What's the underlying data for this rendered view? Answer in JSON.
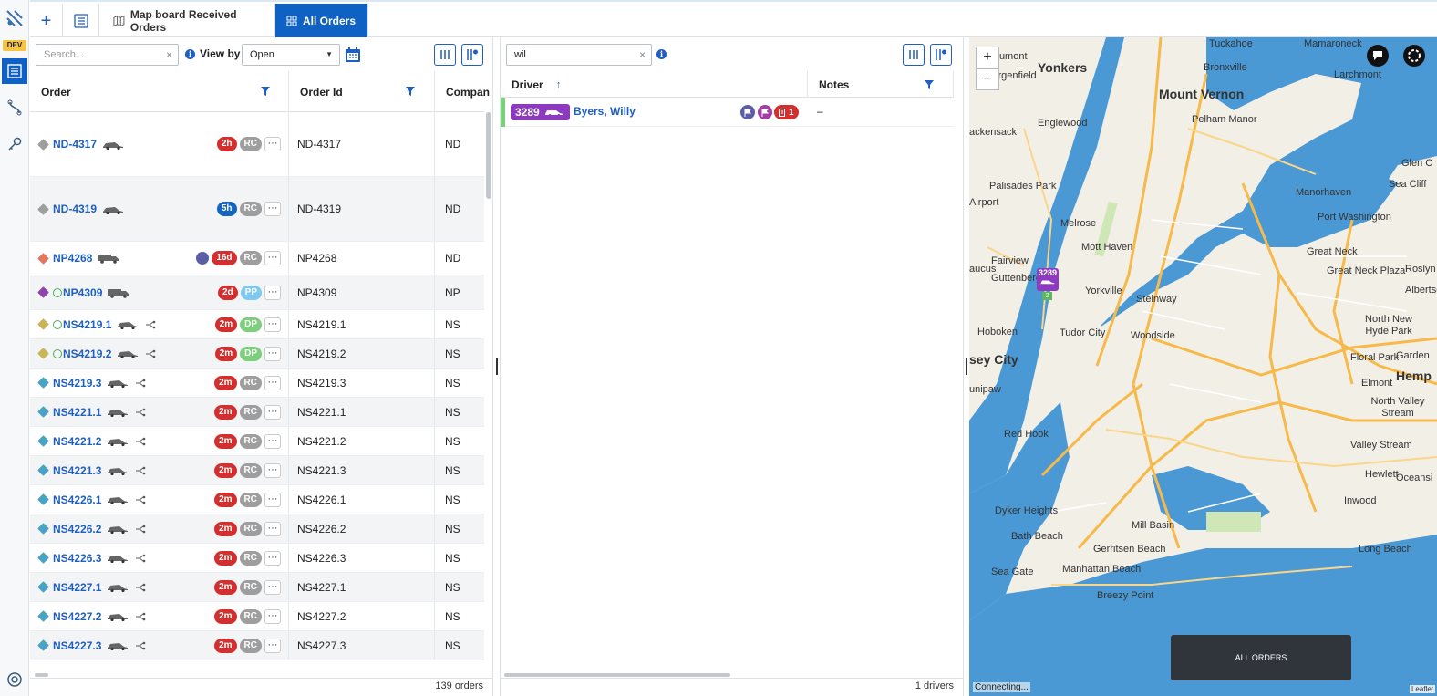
{
  "rail": {
    "dev_badge": "DEV",
    "items": [
      {
        "icon": "app-logo-icon"
      },
      {
        "icon": "orders-list-icon"
      },
      {
        "icon": "route-icon"
      },
      {
        "icon": "key-icon"
      },
      {
        "icon": "help-lifebuoy-icon"
      }
    ]
  },
  "topbar": {
    "add_icon": "plus-icon",
    "list_icon": "list-icon",
    "tabs": [
      {
        "label": "Map board Received Orders",
        "icon": "map-icon",
        "active": false
      },
      {
        "label": "All Orders",
        "icon": "grid-icon",
        "active": true
      }
    ]
  },
  "orders_panel": {
    "search_placeholder": "Search...",
    "view_by_label": "View by",
    "view_by_value": "Open",
    "columns": [
      "Order",
      "Order Id",
      "Compan"
    ],
    "rows": [
      {
        "name": "ND-4317",
        "tag": "#9e9e9e",
        "vehicle": "car",
        "age": "2h",
        "age_color": "red",
        "status": "RC",
        "order_id": "ND-4317",
        "company": "ND",
        "flag": false,
        "app": false,
        "branch": false,
        "tall": true
      },
      {
        "name": "ND-4319",
        "tag": "#9e9e9e",
        "vehicle": "car",
        "age": "5h",
        "age_color": "blue",
        "status": "RC",
        "order_id": "ND-4319",
        "company": "ND",
        "flag": false,
        "app": false,
        "branch": false,
        "tall": true
      },
      {
        "name": "NP4268",
        "tag": "#e07a5f",
        "vehicle": "truck",
        "age": "16d",
        "age_color": "red",
        "status": "RC",
        "order_id": "NP4268",
        "company": "ND",
        "flag": true,
        "app": false,
        "branch": false,
        "tall": false
      },
      {
        "name": "NP4309",
        "tag": "#8e44ad",
        "vehicle": "truck",
        "age": "2d",
        "age_color": "red",
        "status": "PP",
        "order_id": "NP4309",
        "company": "NP",
        "flag": false,
        "app": true,
        "branch": false,
        "tall": false
      },
      {
        "name": "NS4219.1",
        "tag": "#c9b458",
        "vehicle": "car",
        "age": "2m",
        "age_color": "red",
        "status": "DP",
        "order_id": "NS4219.1",
        "company": "NS",
        "flag": false,
        "app": true,
        "branch": true,
        "tall": false
      },
      {
        "name": "NS4219.2",
        "tag": "#c9b458",
        "vehicle": "car",
        "age": "2m",
        "age_color": "red",
        "status": "DP",
        "order_id": "NS4219.2",
        "company": "NS",
        "flag": false,
        "app": true,
        "branch": true,
        "tall": false
      },
      {
        "name": "NS4219.3",
        "tag": "#4aa3c7",
        "vehicle": "car",
        "age": "2m",
        "age_color": "red",
        "status": "RC",
        "order_id": "NS4219.3",
        "company": "NS",
        "flag": false,
        "app": false,
        "branch": true,
        "tall": false
      },
      {
        "name": "NS4221.1",
        "tag": "#4aa3c7",
        "vehicle": "car",
        "age": "2m",
        "age_color": "red",
        "status": "RC",
        "order_id": "NS4221.1",
        "company": "NS",
        "flag": false,
        "app": false,
        "branch": true,
        "tall": false
      },
      {
        "name": "NS4221.2",
        "tag": "#4aa3c7",
        "vehicle": "car",
        "age": "2m",
        "age_color": "red",
        "status": "RC",
        "order_id": "NS4221.2",
        "company": "NS",
        "flag": false,
        "app": false,
        "branch": true,
        "tall": false
      },
      {
        "name": "NS4221.3",
        "tag": "#4aa3c7",
        "vehicle": "car",
        "age": "2m",
        "age_color": "red",
        "status": "RC",
        "order_id": "NS4221.3",
        "company": "NS",
        "flag": false,
        "app": false,
        "branch": true,
        "tall": false
      },
      {
        "name": "NS4226.1",
        "tag": "#4aa3c7",
        "vehicle": "car",
        "age": "2m",
        "age_color": "red",
        "status": "RC",
        "order_id": "NS4226.1",
        "company": "NS",
        "flag": false,
        "app": false,
        "branch": true,
        "tall": false
      },
      {
        "name": "NS4226.2",
        "tag": "#4aa3c7",
        "vehicle": "car",
        "age": "2m",
        "age_color": "red",
        "status": "RC",
        "order_id": "NS4226.2",
        "company": "NS",
        "flag": false,
        "app": false,
        "branch": true,
        "tall": false
      },
      {
        "name": "NS4226.3",
        "tag": "#4aa3c7",
        "vehicle": "car",
        "age": "2m",
        "age_color": "red",
        "status": "RC",
        "order_id": "NS4226.3",
        "company": "NS",
        "flag": false,
        "app": false,
        "branch": true,
        "tall": false
      },
      {
        "name": "NS4227.1",
        "tag": "#4aa3c7",
        "vehicle": "car",
        "age": "2m",
        "age_color": "red",
        "status": "RC",
        "order_id": "NS4227.1",
        "company": "NS",
        "flag": false,
        "app": false,
        "branch": true,
        "tall": false
      },
      {
        "name": "NS4227.2",
        "tag": "#4aa3c7",
        "vehicle": "car",
        "age": "2m",
        "age_color": "red",
        "status": "RC",
        "order_id": "NS4227.2",
        "company": "NS",
        "flag": false,
        "app": false,
        "branch": true,
        "tall": false
      },
      {
        "name": "NS4227.3",
        "tag": "#4aa3c7",
        "vehicle": "car",
        "age": "2m",
        "age_color": "red",
        "status": "RC",
        "order_id": "NS4227.3",
        "company": "NS",
        "flag": false,
        "app": false,
        "branch": true,
        "tall": false
      }
    ],
    "footer": "139 orders"
  },
  "drivers_panel": {
    "search_value": "wil",
    "columns": [
      "Driver",
      "Notes"
    ],
    "rows": [
      {
        "vehicle_id": "3289",
        "name": "Byers, Willy",
        "notes": "–",
        "count": "1"
      }
    ],
    "footer": "1 drivers"
  },
  "map": {
    "zoom_in": "+",
    "zoom_out": "−",
    "marker_id": "3289",
    "marker_sub": "2",
    "places": [
      {
        "t": "Tuckahoe",
        "b": false
      },
      {
        "t": "Mamaroneck",
        "b": false
      },
      {
        "t": "Dumont",
        "b": false
      },
      {
        "t": "Yonkers",
        "b": true
      },
      {
        "t": "Bronxville",
        "b": false
      },
      {
        "t": "Larchmont",
        "b": false
      },
      {
        "t": "Bergenfield",
        "b": false
      },
      {
        "t": "Mount Vernon",
        "b": true
      },
      {
        "t": "Pelham Manor",
        "b": false
      },
      {
        "t": "Englewood",
        "b": false
      },
      {
        "t": "ackensack",
        "b": false
      },
      {
        "t": "Palisades Park",
        "b": false
      },
      {
        "t": "Manorhaven",
        "b": false
      },
      {
        "t": "Port Washington",
        "b": false
      },
      {
        "t": "Fairview",
        "b": false
      },
      {
        "t": "Melrose",
        "b": false
      },
      {
        "t": "Great Neck",
        "b": false
      },
      {
        "t": "Great Neck Plaza",
        "b": false
      },
      {
        "t": "Roslyn Height",
        "b": false
      },
      {
        "t": "Guttenberg",
        "b": false
      },
      {
        "t": "Mott Haven",
        "b": false
      },
      {
        "t": "Yorkville",
        "b": false
      },
      {
        "t": "Steinway",
        "b": false
      },
      {
        "t": "Hoboken",
        "b": false
      },
      {
        "t": "Tudor City",
        "b": false
      },
      {
        "t": "Woodside",
        "b": false
      },
      {
        "t": "North New Hyde Park",
        "b": false
      },
      {
        "t": "sey City",
        "b": true
      },
      {
        "t": "Floral Park",
        "b": false
      },
      {
        "t": "Elmont",
        "b": false
      },
      {
        "t": "Hemp",
        "b": true
      },
      {
        "t": "North Valley Stream",
        "b": false
      },
      {
        "t": "Red Hook",
        "b": false
      },
      {
        "t": "Valley Stream",
        "b": false
      },
      {
        "t": "Hewlett",
        "b": false
      },
      {
        "t": "Inwood",
        "b": false
      },
      {
        "t": "Dyker Heights",
        "b": false
      },
      {
        "t": "Mill Basin",
        "b": false
      },
      {
        "t": "Bath Beach",
        "b": false
      },
      {
        "t": "Gerritsen Beach",
        "b": false
      },
      {
        "t": "Long Beach",
        "b": false
      },
      {
        "t": "Sea Gate",
        "b": false
      },
      {
        "t": "Manhattan Beach",
        "b": false
      },
      {
        "t": "Breezy Point",
        "b": false
      },
      {
        "t": "Glen C",
        "b": false
      },
      {
        "t": "Sea Cliff",
        "b": false
      },
      {
        "t": "Albertso",
        "b": false
      },
      {
        "t": "Garden",
        "b": false
      },
      {
        "t": "Oceansi",
        "b": false
      },
      {
        "t": "Airport",
        "b": false
      },
      {
        "t": "aucus",
        "b": false
      },
      {
        "t": "unipaw",
        "b": false
      }
    ],
    "all_orders_button": "ALL ORDERS",
    "status": "Connecting...",
    "attribution": "Leaflet",
    "colors": {
      "water": "#4a98d4",
      "land": "#f2efe6",
      "highway": "#f6b94a"
    }
  }
}
